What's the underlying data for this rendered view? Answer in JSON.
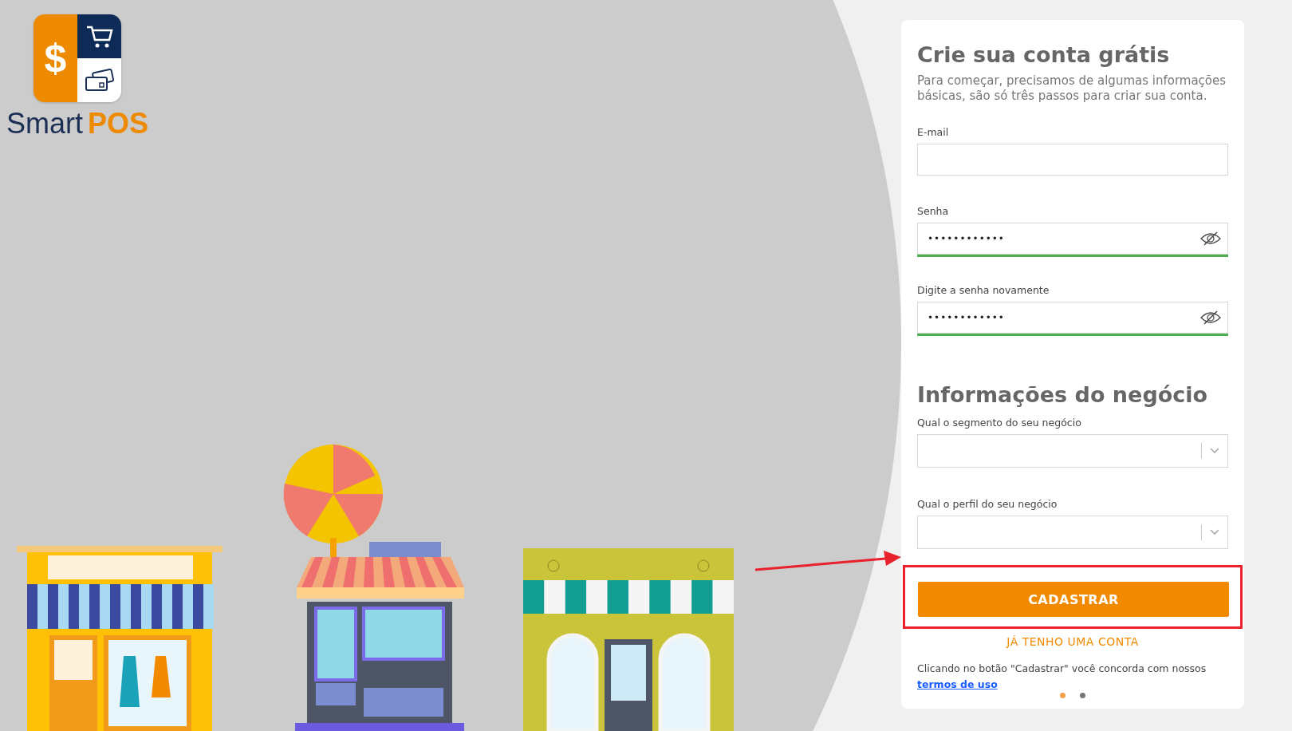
{
  "logo": {
    "symbol": "$",
    "name_part_1": "Smart",
    "name_part_2": "POS"
  },
  "form": {
    "title": "Crie sua conta grátis",
    "intro": "Para começar, precisamos de algumas informações básicas, são só três passos para criar sua conta.",
    "fields": [
      {
        "kind": "text",
        "label": "E-mail"
      },
      {
        "kind": "password",
        "label": "Senha",
        "value": "••••••••••••",
        "valid": true
      },
      {
        "kind": "password",
        "label": "Digite a senha novamente",
        "value": "••••••••••••",
        "valid": true
      }
    ],
    "section_title": "Informações do negócio",
    "selects": [
      {
        "label": "Qual o segmento do seu negócio"
      },
      {
        "label": "Qual o perfil do seu negócio"
      }
    ],
    "submit": "CADASTRAR",
    "highlighted": true,
    "login_link": "JÁ TENHO UMA CONTA",
    "terms_text": "Clicando no botão \"Cadastrar\" você concorda com nossos ",
    "terms_link": "termos de uso",
    "steps": [
      {
        "selected": true
      },
      {
        "selected": false
      }
    ]
  }
}
